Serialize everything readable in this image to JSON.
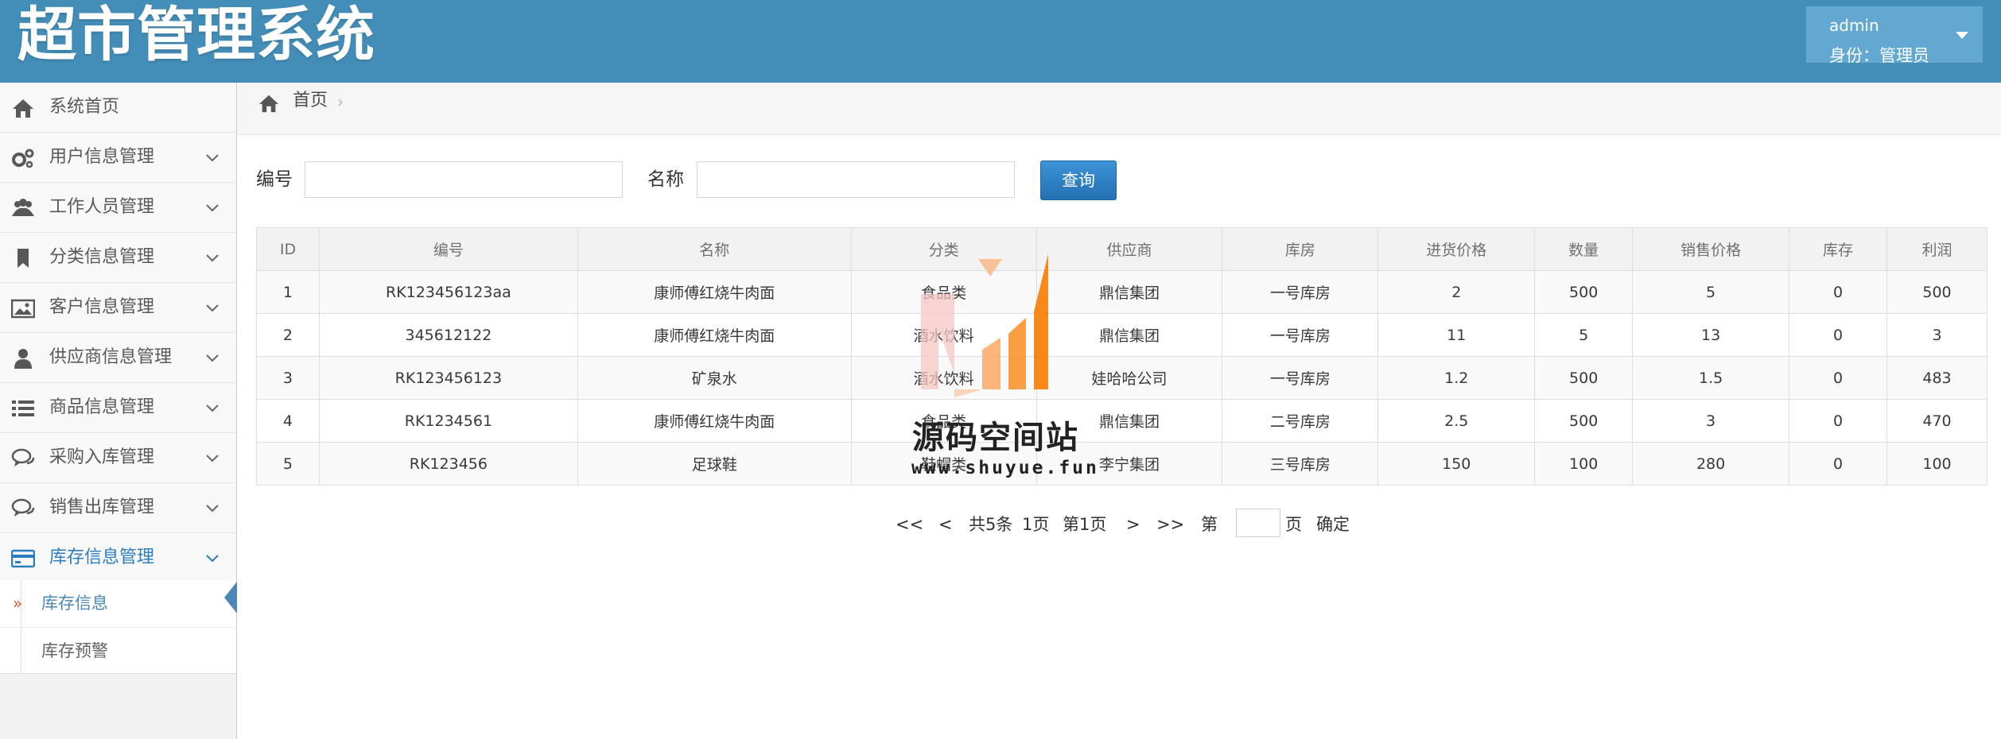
{
  "header": {
    "title": "超市管理系统",
    "user": {
      "name": "admin",
      "role": "身份：管理员"
    }
  },
  "sidebar": {
    "items": [
      {
        "label": "系统首页",
        "icon": "home-icon",
        "expandable": false
      },
      {
        "label": "用户信息管理",
        "icon": "gears-icon",
        "expandable": true
      },
      {
        "label": "工作人员管理",
        "icon": "users-icon",
        "expandable": true
      },
      {
        "label": "分类信息管理",
        "icon": "bookmark-icon",
        "expandable": true
      },
      {
        "label": "客户信息管理",
        "icon": "picture-icon",
        "expandable": true
      },
      {
        "label": "供应商信息管理",
        "icon": "user-icon",
        "expandable": true
      },
      {
        "label": "商品信息管理",
        "icon": "list-icon",
        "expandable": true
      },
      {
        "label": "采购入库管理",
        "icon": "comments-icon",
        "expandable": true
      },
      {
        "label": "销售出库管理",
        "icon": "comments-icon",
        "expandable": true
      },
      {
        "label": "库存信息管理",
        "icon": "credit-card-icon",
        "expandable": true,
        "active": true
      }
    ],
    "submenu": [
      {
        "label": "库存信息",
        "active": true
      },
      {
        "label": "库存预警",
        "active": false
      }
    ]
  },
  "breadcrumb": {
    "home": "首页"
  },
  "search": {
    "code_label": "编号",
    "code_value": "",
    "name_label": "名称",
    "name_value": "",
    "button": "查询"
  },
  "table": {
    "columns": [
      "ID",
      "编号",
      "名称",
      "分类",
      "供应商",
      "库房",
      "进货价格",
      "数量",
      "销售价格",
      "库存",
      "利润"
    ],
    "rows": [
      [
        "1",
        "RK123456123aa",
        "康师傅红烧牛肉面",
        "食品类",
        "鼎信集团",
        "一号库房",
        "2",
        "500",
        "5",
        "0",
        "500"
      ],
      [
        "2",
        "345612122",
        "康师傅红烧牛肉面",
        "酒水饮料",
        "鼎信集团",
        "一号库房",
        "11",
        "5",
        "13",
        "0",
        "3"
      ],
      [
        "3",
        "RK123456123",
        "矿泉水",
        "酒水饮料",
        "娃哈哈公司",
        "一号库房",
        "1.2",
        "500",
        "1.5",
        "0",
        "483"
      ],
      [
        "4",
        "RK1234561",
        "康师傅红烧牛肉面",
        "食品类",
        "鼎信集团",
        "二号库房",
        "2.5",
        "500",
        "3",
        "0",
        "470"
      ],
      [
        "5",
        "RK123456",
        "足球鞋",
        "鞋帽类",
        "李宁集团",
        "三号库房",
        "150",
        "100",
        "280",
        "0",
        "100"
      ]
    ]
  },
  "pagination": {
    "first": "<<",
    "prev": "<",
    "total": "共5条",
    "pages": "1页",
    "current": "第1页",
    "next": ">",
    "last": ">>",
    "goto_prefix": "第",
    "goto_value": "",
    "goto_suffix": "页",
    "confirm": "确定"
  },
  "watermark": {
    "title": "源码空间站",
    "url": "www.shuyue.fun"
  },
  "colors": {
    "header": "#438eb9",
    "user_box": "#62a8d1",
    "active": "#2b7dbc",
    "button": "#2b7dbc"
  }
}
